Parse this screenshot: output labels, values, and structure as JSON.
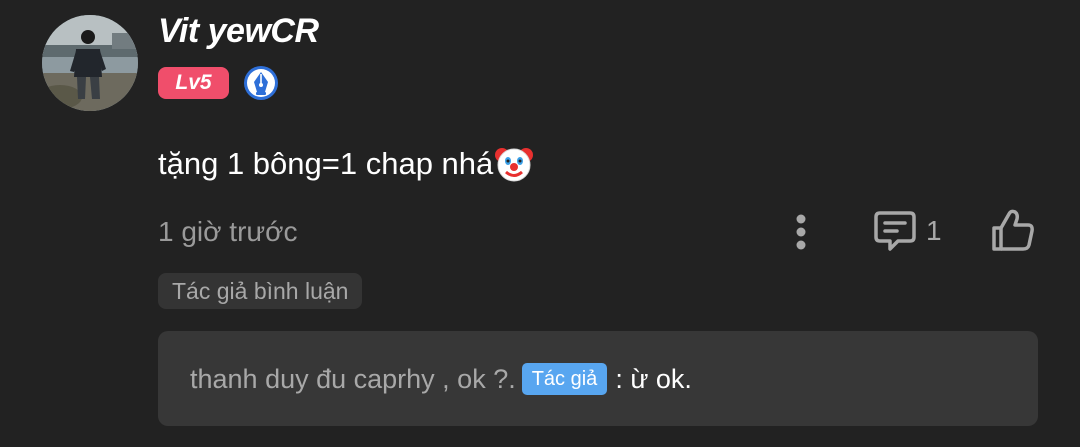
{
  "user": {
    "name": "Vit yewCR",
    "level": "Lv5",
    "avatar_icon": "avatar-photo",
    "badge_icon": "author-pen-icon"
  },
  "comment": {
    "text": "tặng 1 bông=1 chap nhá",
    "emoji": "clown-face-emoji",
    "time": "1 giờ trước",
    "reply_count": "1",
    "author_comment_label": "Tác giả bình luận"
  },
  "reply": {
    "prefix": "thanh duy đu caprhy , ok ?.",
    "author_tag": "Tác giả",
    "text": ": ừ ok."
  },
  "colors": {
    "background": "#222222",
    "level_badge": "#f04e6b",
    "author_tag": "#58a6f0",
    "muted_text": "#9a9a9a",
    "reply_box": "#373737"
  },
  "icons": {
    "more": "more-vertical-icon",
    "reply": "comment-icon",
    "like": "thumbs-up-icon"
  }
}
